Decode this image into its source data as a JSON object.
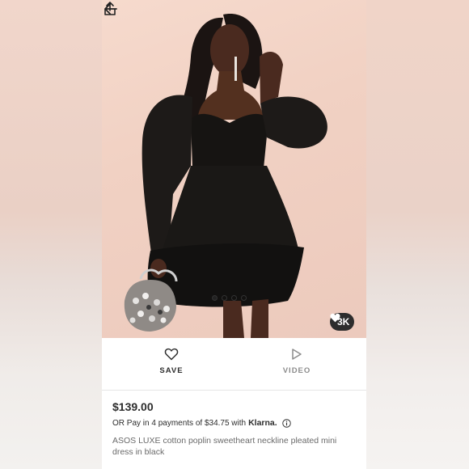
{
  "nav": {
    "back_icon": "arrow-left-icon",
    "share_icon": "share-upload-icon"
  },
  "gallery": {
    "total_images": 4,
    "active_index": 0,
    "likes_count": "3K",
    "likes_icon": "heart-icon"
  },
  "actions": {
    "save_label": "SAVE",
    "save_icon": "heart-outline-icon",
    "video_label": "VIDEO",
    "video_icon": "play-icon"
  },
  "product": {
    "price": "$139.00",
    "payment_prefix": "OR Pay in 4 payments of $34.75 with",
    "payment_provider": "Klarna.",
    "info_icon": "info-icon",
    "title": "ASOS LUXE cotton poplin sweetheart neckline pleated mini dress in black"
  },
  "colors": {
    "text_primary": "#2d2d2d",
    "text_muted": "#8c8c8c",
    "title_grey": "#6a6a6a",
    "badge_bg": "#2d2d2d"
  }
}
